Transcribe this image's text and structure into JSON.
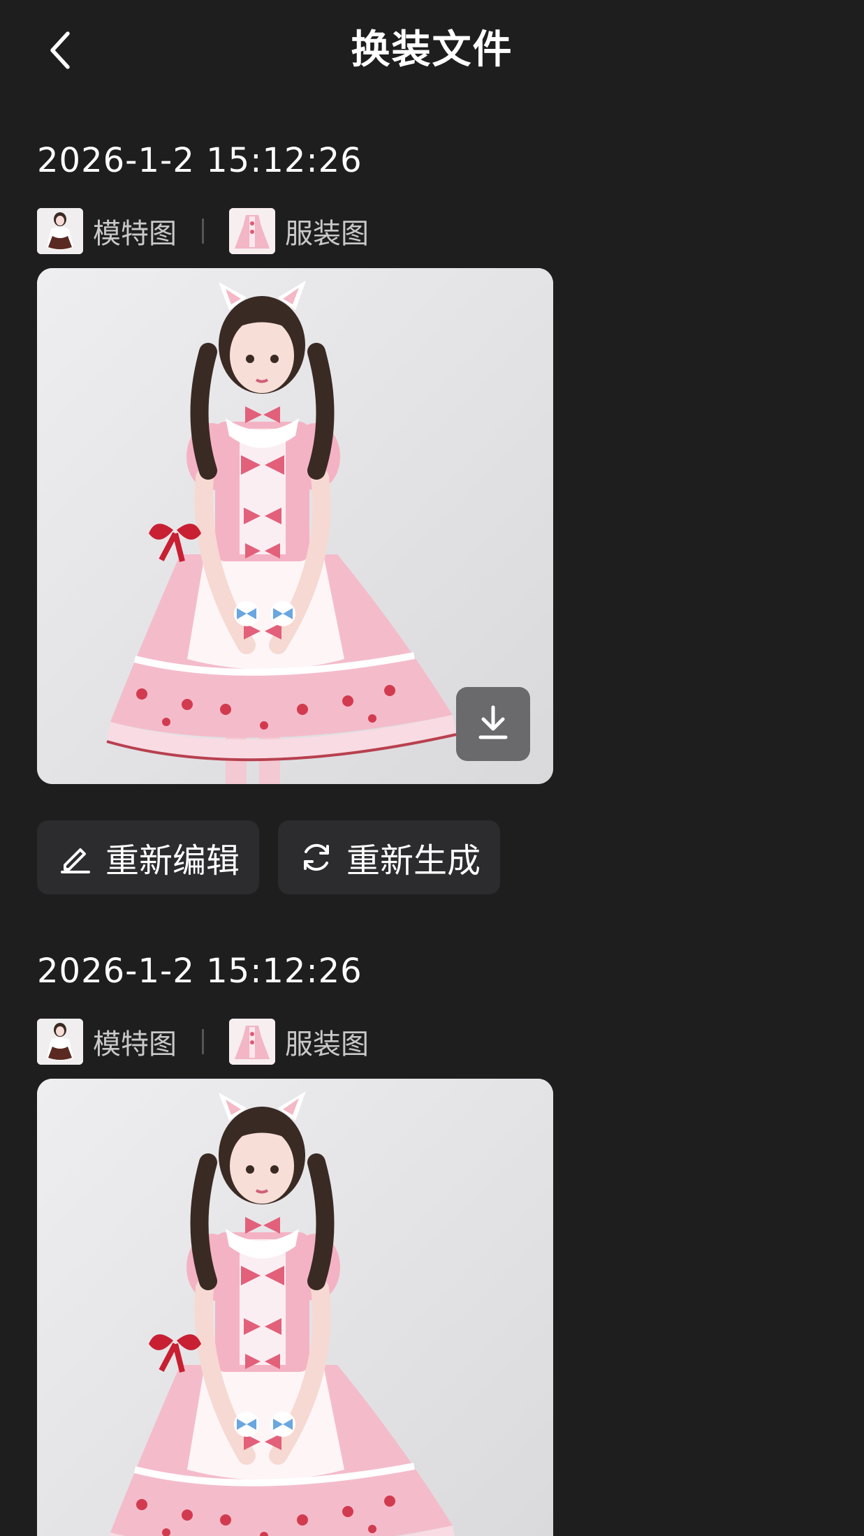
{
  "header": {
    "back_icon": "chevron-left-icon",
    "title": "换装文件"
  },
  "records": [
    {
      "time": "2026-1-2 15:12:26",
      "model_label": "模特图",
      "clothing_label": "服装图",
      "download_icon": "download-icon",
      "re_edit_label": "重新编辑",
      "re_edit_icon": "pencil-icon",
      "regenerate_label": "重新生成",
      "regenerate_icon": "refresh-icon"
    },
    {
      "time": "2026-1-2 15:12:26",
      "model_label": "模特图",
      "clothing_label": "服装图"
    }
  ],
  "colors": {
    "background": "#1e1e1f",
    "button_bg": "#2c2c2e",
    "label_gray": "#c9c9c9",
    "dress_pink": "#f2b8c8",
    "bow_red": "#d6455f"
  }
}
